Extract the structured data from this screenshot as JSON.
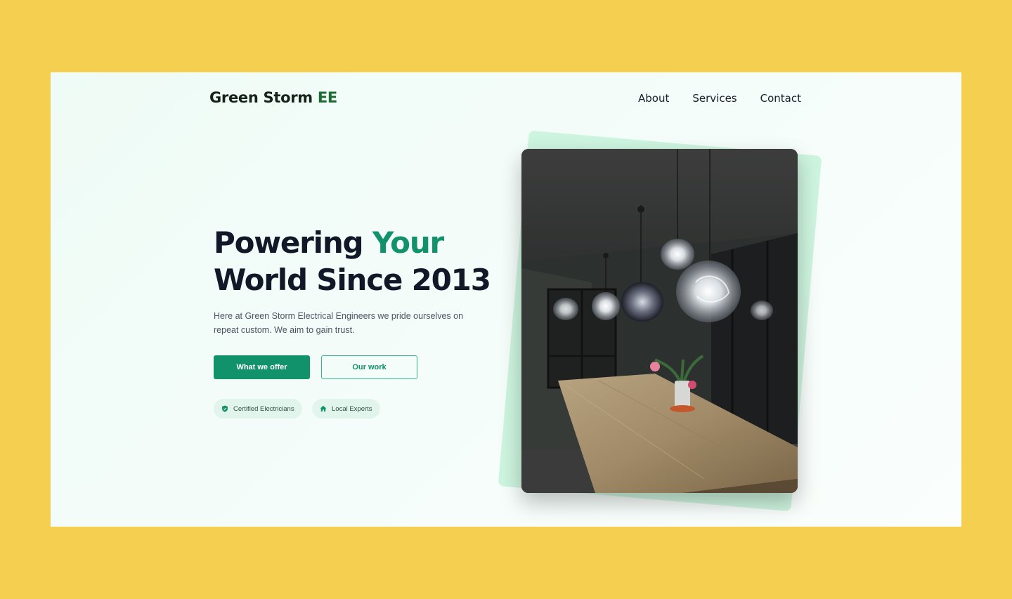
{
  "brand": {
    "name": "Green Storm ",
    "accent": "EE"
  },
  "nav": {
    "about": "About",
    "services": "Services",
    "contact": "Contact"
  },
  "hero": {
    "headline_part1": "Powering ",
    "headline_highlight": "Your",
    "headline_part2": "World Since 2013",
    "description": "Here at Green Storm Electrical Engineers we pride ourselves on repeat custom. We aim to gain trust.",
    "primary_button": "What we offer",
    "secondary_button": "Our work",
    "badges": [
      {
        "label": "Certified Electricians",
        "icon": "shield-icon"
      },
      {
        "label": "Local Experts",
        "icon": "home-icon"
      }
    ],
    "image_icon": "dining-room-pendant-lights-photo"
  },
  "colors": {
    "page_background": "#f5cf4f",
    "accent_green": "#12926a",
    "brand_dark_green": "#1f6b35",
    "heading": "#111827"
  }
}
